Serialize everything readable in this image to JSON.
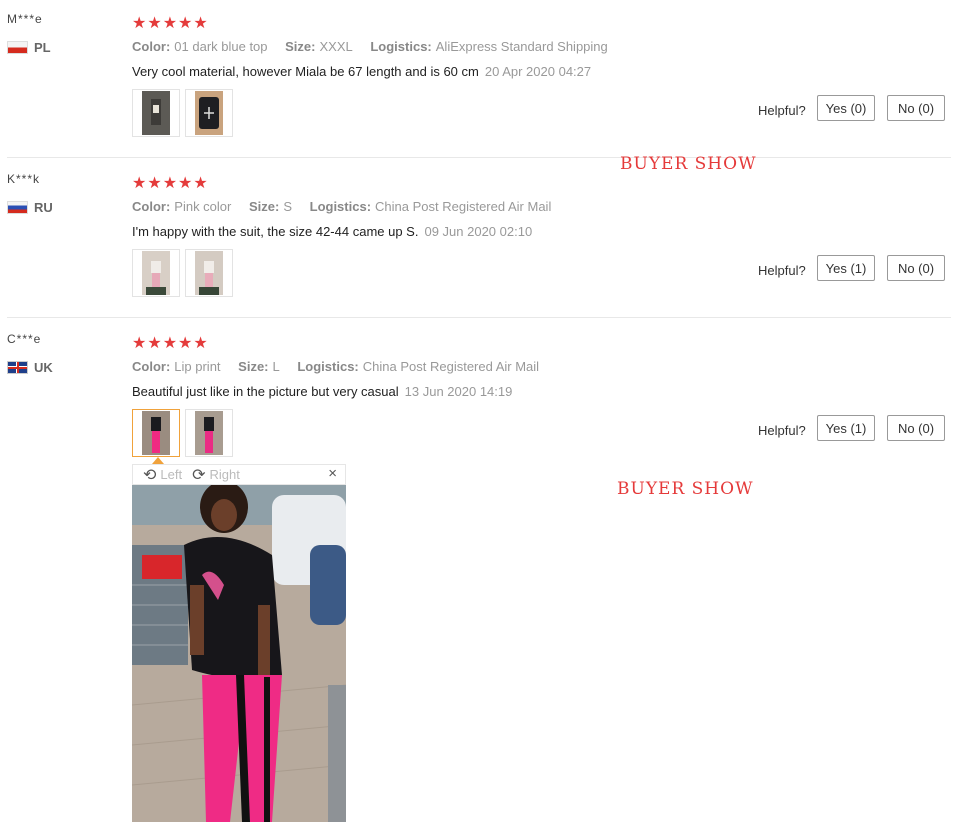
{
  "reviews": [
    {
      "user": "M***e",
      "country": "PL",
      "stars": "★★★★★",
      "color_label": "Color:",
      "color": "01 dark blue top",
      "size_label": "Size:",
      "size": "XXXL",
      "logistics_label": "Logistics:",
      "logistics": "AliExpress Standard Shipping",
      "text": "Very cool material, however Miala be 67 length and is 60 cm",
      "date": "20 Apr 2020 04:27",
      "helpful": "Helpful?",
      "yes": "Yes (0)",
      "no": "No (0)"
    },
    {
      "user": "K***k",
      "country": "RU",
      "stars": "★★★★★",
      "color_label": "Color:",
      "color": "Pink color",
      "size_label": "Size:",
      "size": "S",
      "logistics_label": "Logistics:",
      "logistics": "China Post Registered Air Mail",
      "text": "I'm happy with the suit, the size 42-44 came up S.",
      "date": "09 Jun 2020 02:10",
      "helpful": "Helpful?",
      "yes": "Yes (1)",
      "no": "No (0)"
    },
    {
      "user": "C***e",
      "country": "UK",
      "stars": "★★★★★",
      "color_label": "Color:",
      "color": "Lip print",
      "size_label": "Size:",
      "size": "L",
      "logistics_label": "Logistics:",
      "logistics": "China Post Registered Air Mail",
      "text": "Beautiful just like in the picture but very casual",
      "date": "13 Jun 2020 14:19",
      "helpful": "Helpful?",
      "yes": "Yes (1)",
      "no": "No (0)"
    }
  ],
  "watermarks": [
    "BUYER  SHOW",
    "BUYER   SHOW"
  ],
  "viewer": {
    "left": "Left",
    "right": "Right",
    "close": "×"
  },
  "colors": {
    "star": "#e43b3b",
    "watermark": "#e53a3a",
    "active_thumb": "#f0a23b"
  }
}
